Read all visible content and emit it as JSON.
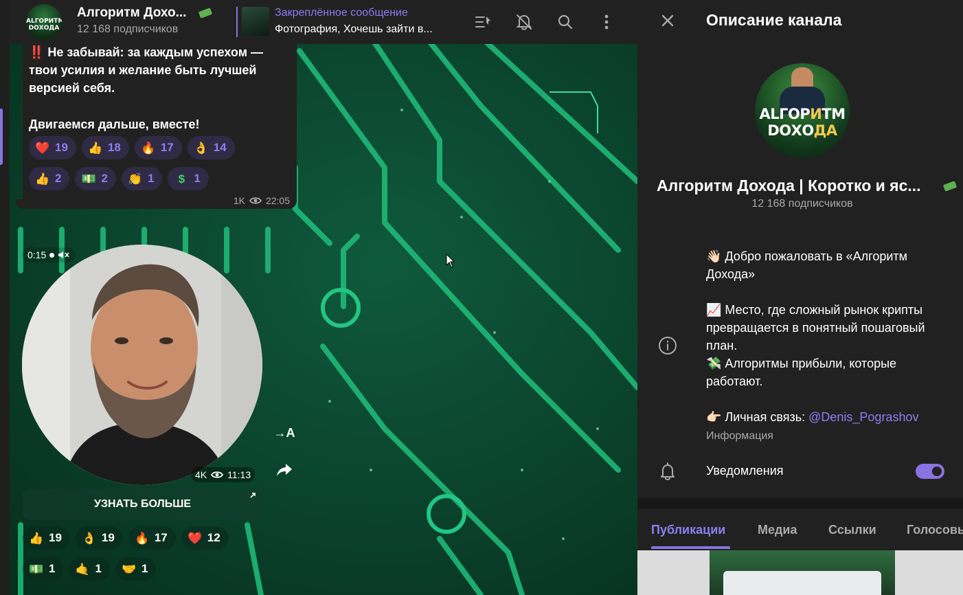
{
  "header": {
    "title": "Алгоритм Дохо...",
    "subscribers": "12 168 подписчиков",
    "avatar_text_1": "АLГОРИТМ",
    "avatar_text_2": "DОХОДА",
    "pinned_label": "Закреплённое сообщение",
    "pinned_text": "Фотография, Хочешь зайти в...",
    "icons": [
      "pin-list-icon",
      "bell-off-icon",
      "search-icon",
      "more-vertical-icon"
    ]
  },
  "message": {
    "lines": [
      "‼️ Не забывай: за каждым успехом —",
      "твои усилия и желание быть лучшей",
      "версией себя.",
      "Двигаемся дальше, вместе!"
    ],
    "reactions_row1": [
      {
        "emoji": "❤️",
        "count": "19",
        "icon": "heart-icon"
      },
      {
        "emoji": "👍",
        "count": "18",
        "icon": "thumbs-up-icon"
      },
      {
        "emoji": "🔥",
        "count": "17",
        "icon": "fire-icon"
      },
      {
        "emoji": "👌",
        "count": "14",
        "icon": "ok-hand-icon"
      }
    ],
    "reactions_row2": [
      {
        "emoji": "👍",
        "count": "2",
        "icon": "green-thumbs-up-icon"
      },
      {
        "emoji": "💵",
        "count": "2",
        "icon": "money-icon"
      },
      {
        "emoji": "👏",
        "count": "1",
        "icon": "clap-icon"
      },
      {
        "emoji": "$",
        "count": "1",
        "icon": "dollar-icon"
      }
    ],
    "views": "1K",
    "time": "22:05"
  },
  "video_message": {
    "duration": "0:15",
    "views": "4K",
    "time": "11:13",
    "translate_label": "→A",
    "button_label": "УЗНАТЬ БОЛЬШЕ",
    "reactions_row1": [
      {
        "emoji": "👍",
        "count": "19",
        "icon": "thumbs-up-icon"
      },
      {
        "emoji": "👌",
        "count": "19",
        "icon": "ok-hand-icon"
      },
      {
        "emoji": "🔥",
        "count": "17",
        "icon": "fire-icon"
      },
      {
        "emoji": "❤️",
        "count": "12",
        "icon": "heart-icon"
      }
    ],
    "reactions_row2": [
      {
        "emoji": "💵",
        "count": "1",
        "icon": "money-icon"
      },
      {
        "emoji": "🤙",
        "count": "1",
        "icon": "call-me-hand-icon"
      },
      {
        "emoji": "🤝",
        "count": "1",
        "icon": "handshake-icon"
      }
    ]
  },
  "panel": {
    "title": "Описание канала",
    "avatar_line_1_a": "АLГОР",
    "avatar_line_1_b": "И",
    "avatar_line_1_c": "ТМ",
    "avatar_line_2_a": "DОХО",
    "avatar_line_2_b": "ДА",
    "channel_name": "Алгоритм Дохода | Коротко и яс...",
    "subscribers": "12 168 подписчиков",
    "description": {
      "p1": "👋🏻 Добро пожаловать в «Алгоритм Дохода»",
      "p2a": "📈 Место, где сложный рынок крипты превращается в понятный пошаговый план.",
      "p2b": "💸 Алгоритмы прибыли, которые работают.",
      "p3_prefix": "👉🏻 Личная связь: ",
      "p3_mention": "@Denis_Pograshov"
    },
    "info_label": "Информация",
    "notifications_label": "Уведомления",
    "notifications_on": true,
    "tabs": [
      "Публикации",
      "Медиа",
      "Ссылки",
      "Голосовые"
    ],
    "active_tab": "Публикации"
  },
  "colors": {
    "accent": "#8774e1",
    "accent_text": "#8c7ef0",
    "panel_bg": "#212121",
    "chat_bg": "#0c4a33",
    "circuit": "#2ecf8a"
  }
}
